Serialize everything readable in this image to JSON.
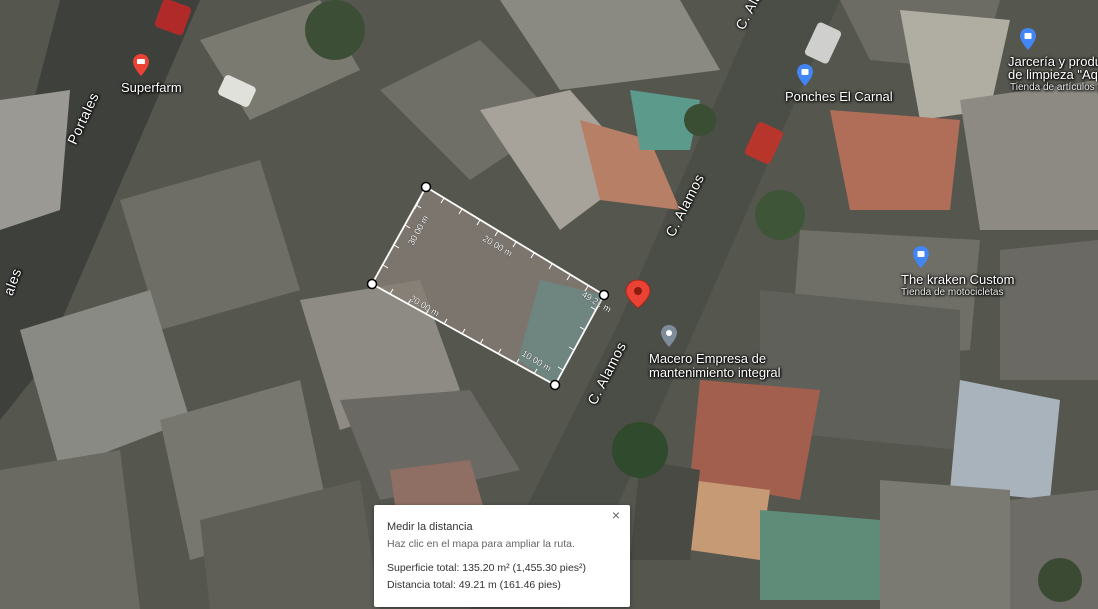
{
  "streets": {
    "alamos_1": "C. Alamos",
    "alamos_2": "C. Alamos",
    "alamos_3": "C. Alamos",
    "portales_1": "Portales",
    "portales_2": "ales"
  },
  "pois": {
    "superfarm": "Superfarm",
    "ponches": "Ponches El Carnal",
    "jarceria_line1": "Jarcería y produ",
    "jarceria_line2": "de limpieza \"Aqu",
    "jarceria_sub": "Tienda de artículos p",
    "kraken": "The kraken Custom",
    "kraken_sub": "Tienda de motocicletas",
    "macero_line1": "Macero Empresa de",
    "macero_line2": "mantenimiento integral"
  },
  "measure": {
    "seg1": "30.00 m",
    "seg2": "20.00 m",
    "seg3": "20.00 m",
    "seg4": "49.21 m",
    "seg5": "10.00 m"
  },
  "panel": {
    "title": "Medir la distancia",
    "hint": "Haz clic en el mapa para ampliar la ruta.",
    "area": "Superficie total: 135.20 m² (1,455.30 pies²)",
    "distance": "Distancia total: 49.21 m (161.46 pies)",
    "close": "×"
  },
  "colors": {
    "pin_red": "#ea4335",
    "poi_blue": "#4285f4",
    "poi_gray": "#7e8c9a",
    "measure_line": "#ffffff"
  }
}
